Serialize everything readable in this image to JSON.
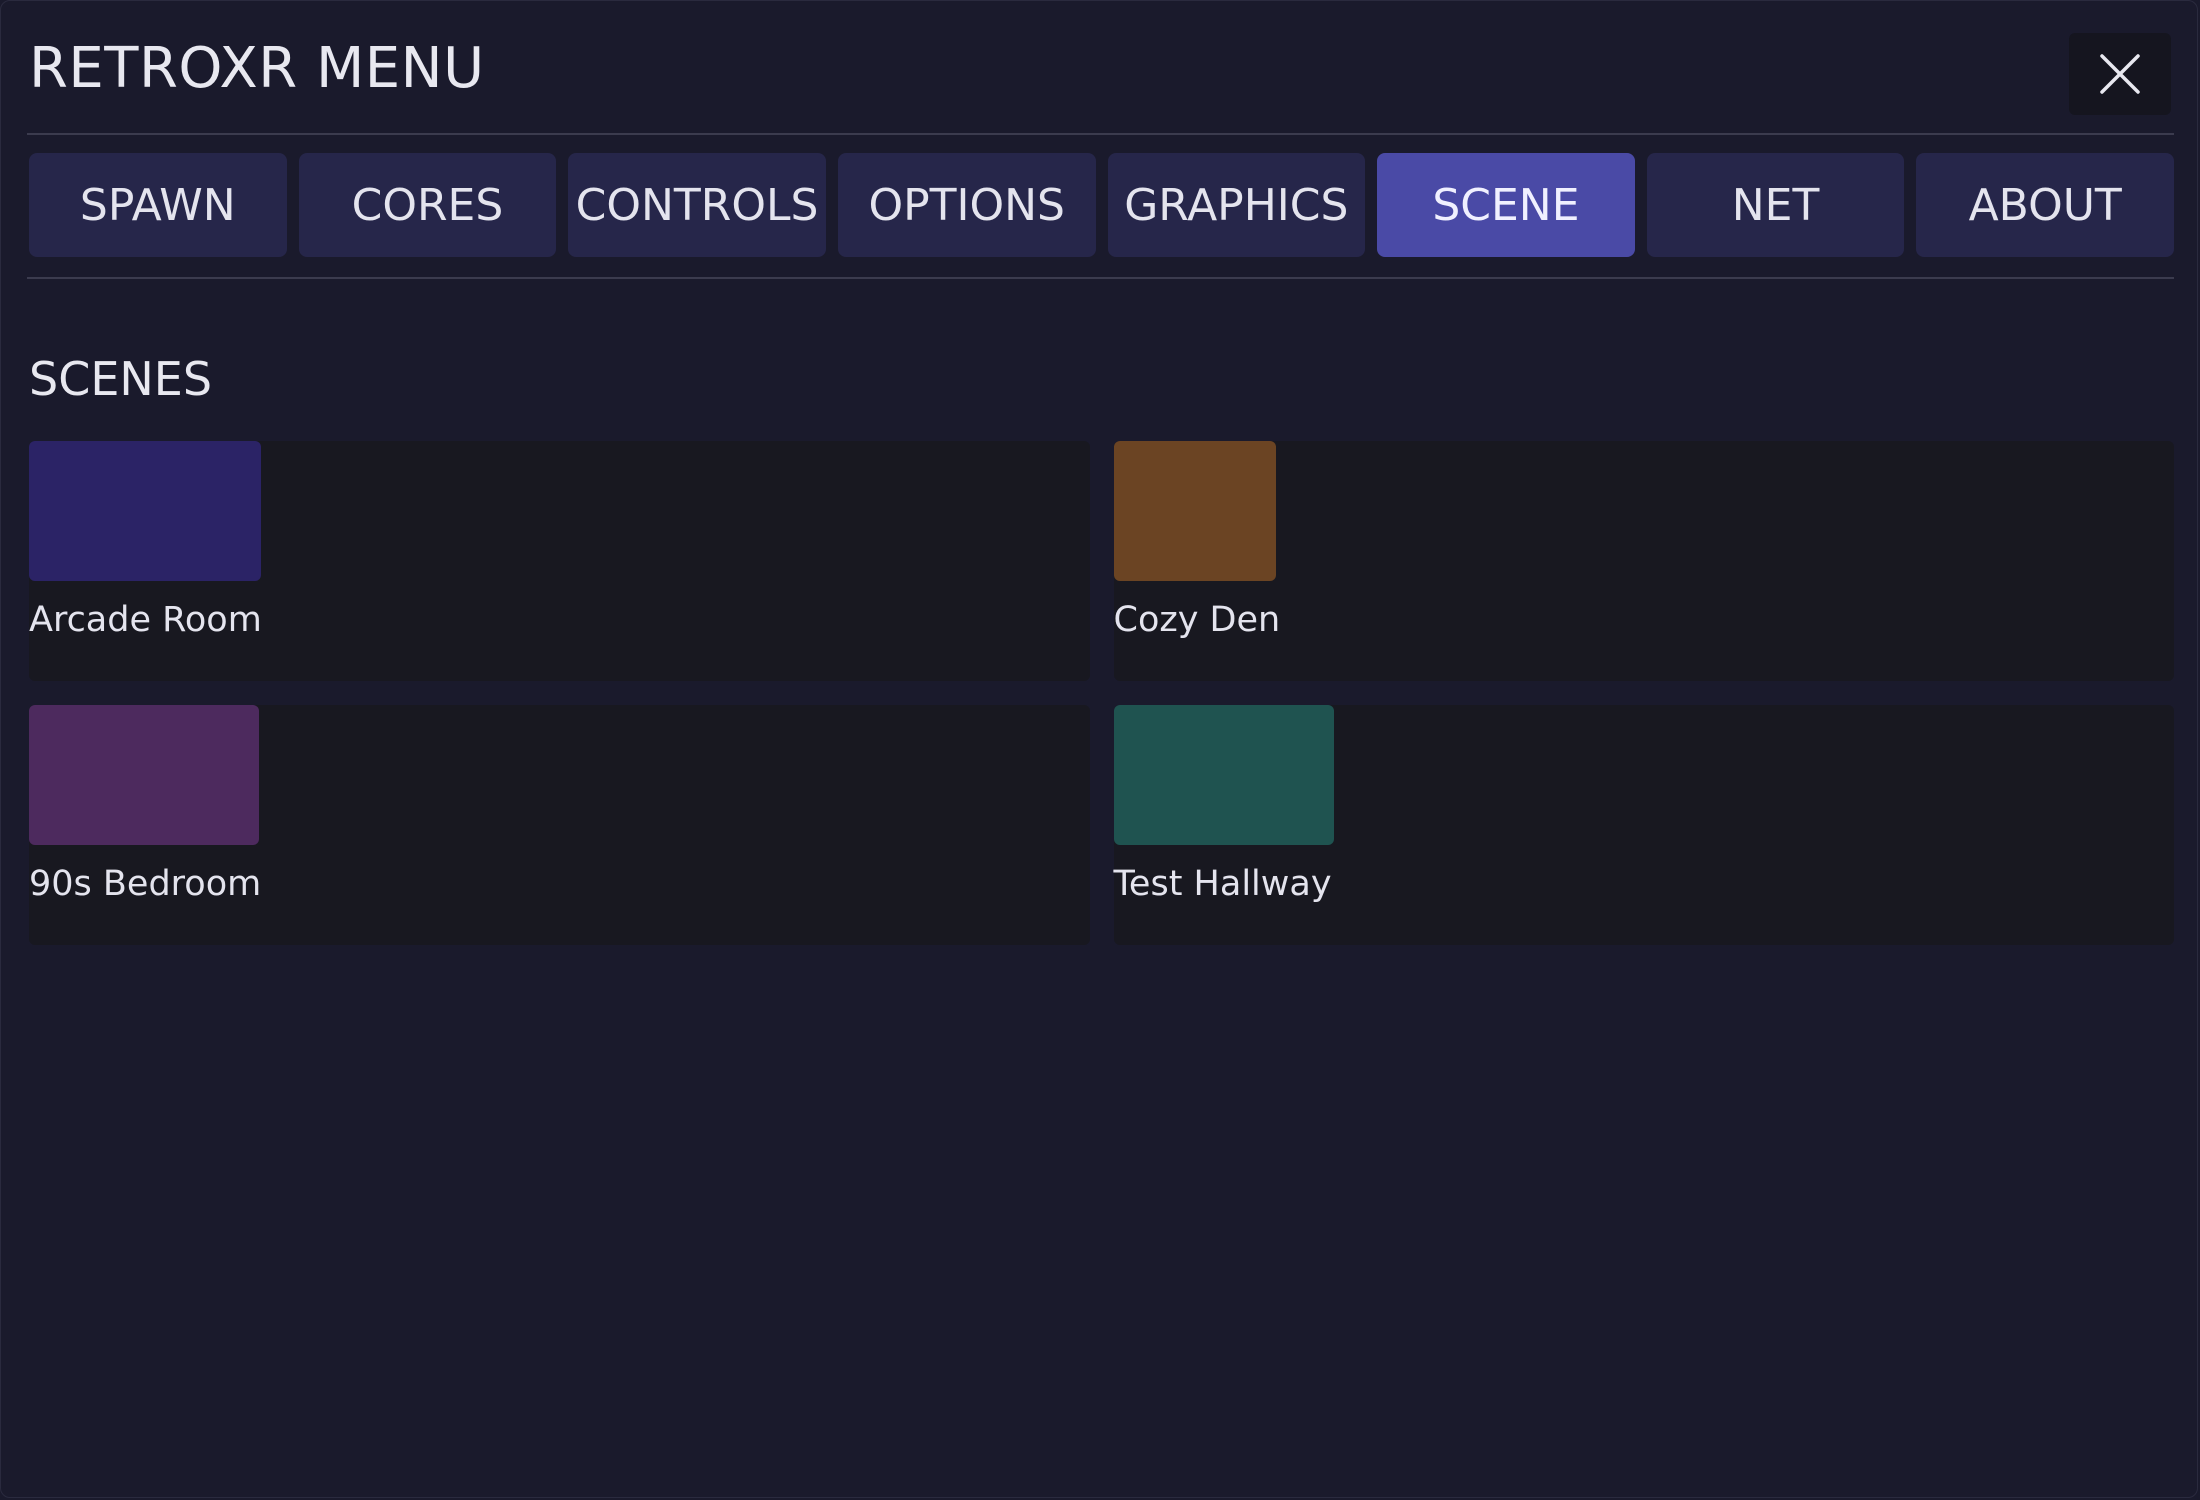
{
  "window": {
    "title": "RETROXR MENU",
    "close_icon": "close-icon"
  },
  "tabs": [
    {
      "label": "SPAWN",
      "active": false
    },
    {
      "label": "CORES",
      "active": false
    },
    {
      "label": "CONTROLS",
      "active": false
    },
    {
      "label": "OPTIONS",
      "active": false
    },
    {
      "label": "GRAPHICS",
      "active": false
    },
    {
      "label": "SCENE",
      "active": true
    },
    {
      "label": "NET",
      "active": false
    },
    {
      "label": "ABOUT",
      "active": false
    }
  ],
  "scenes": {
    "heading": "SCENES",
    "items": [
      {
        "label": "Arcade Room",
        "color": "#2b2366"
      },
      {
        "label": "Cozy Den",
        "color": "#6b4423"
      },
      {
        "label": "90s Bedroom",
        "color": "#4d2a5e"
      },
      {
        "label": "Test Hallway",
        "color": "#1f5350"
      }
    ]
  },
  "colors": {
    "background": "#1a1a2c",
    "tab": "#26264a",
    "tab_active": "#4a4aa6",
    "card": "#181820"
  }
}
